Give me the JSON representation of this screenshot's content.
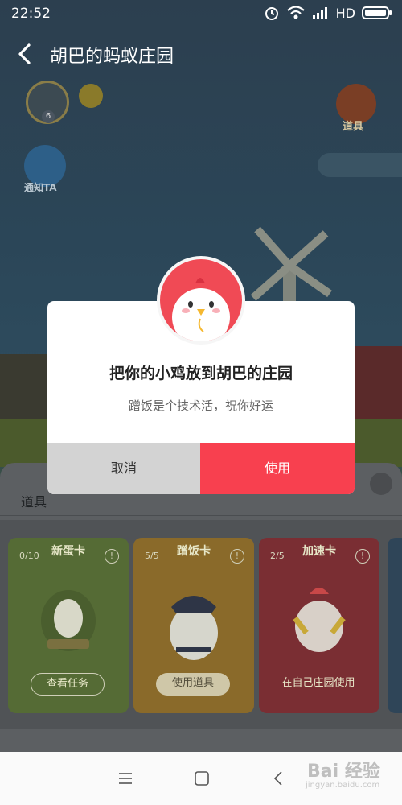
{
  "status_bar": {
    "time": "22:52",
    "network": "HD"
  },
  "header": {
    "title": "胡巴的蚂蚁庄园"
  },
  "scene": {
    "level": "6",
    "props_label": "道具",
    "notify_label": "通知TA"
  },
  "dialog": {
    "title": "把你的小鸡放到胡巴的庄园",
    "subtitle": "蹭饭是个技术活，祝你好运",
    "cancel_label": "取消",
    "confirm_label": "使用"
  },
  "props_panel": {
    "title": "道具",
    "cards": [
      {
        "name": "新蛋卡",
        "count": "0/10",
        "button": "查看任务"
      },
      {
        "name": "蹭饭卡",
        "count": "5/5",
        "button": "使用道具"
      },
      {
        "name": "加速卡",
        "count": "2/5",
        "button": "在自己庄园使用"
      }
    ]
  },
  "watermark": {
    "text": "Bai 经验",
    "sub": "jingyan.baidu.com"
  },
  "colors": {
    "confirm": "#f8404f",
    "cancel": "#d3d3d3",
    "chicken": "#f04a55"
  }
}
